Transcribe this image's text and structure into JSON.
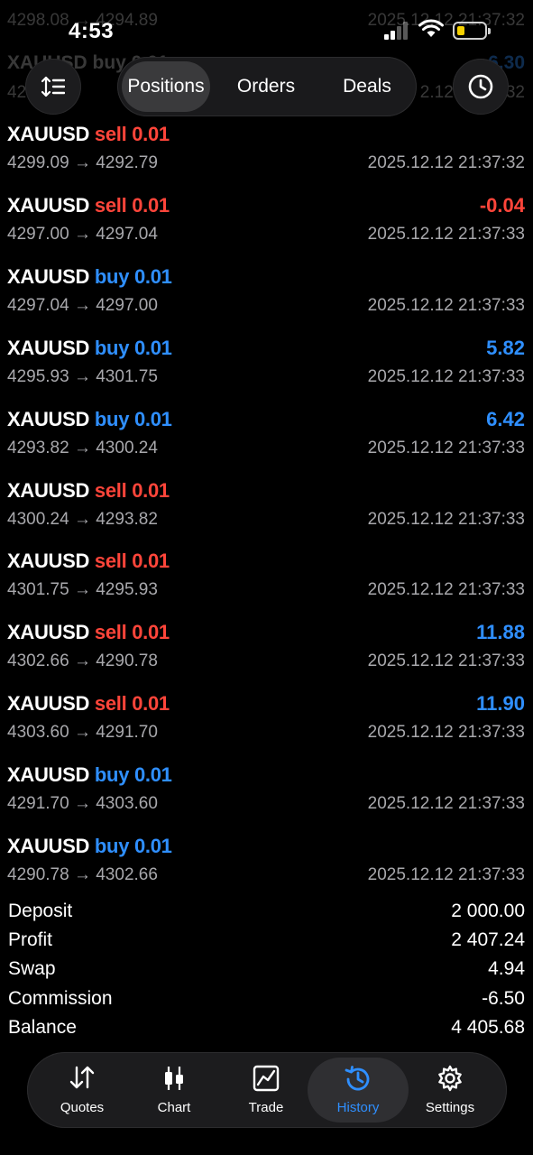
{
  "status_bar": {
    "time": "4:53"
  },
  "ghost_rows": [
    {
      "left": "4298.08 → 4294.89",
      "right": "2025.12.12 21:37:32"
    },
    {
      "left": "XAUUSD buy 0.01",
      "right": "6.30"
    },
    {
      "left": "42 → 42",
      "right": "2.12 21:37:32"
    }
  ],
  "toolbar": {
    "segments": [
      "Positions",
      "Orders",
      "Deals"
    ],
    "active_segment": "Positions"
  },
  "deals": [
    {
      "symbol": "XAUUSD",
      "side": "sell",
      "volume": "0.01",
      "profit": "",
      "prices": "4299.09 → 4292.79",
      "time": "2025.12.12 21:37:32"
    },
    {
      "symbol": "XAUUSD",
      "side": "sell",
      "volume": "0.01",
      "profit": "-0.04",
      "profit_color": "#ff453a",
      "prices": "4297.00 → 4297.04",
      "time": "2025.12.12 21:37:33"
    },
    {
      "symbol": "XAUUSD",
      "side": "buy",
      "volume": "0.01",
      "profit": "",
      "prices": "4297.04 → 4297.00",
      "time": "2025.12.12 21:37:33"
    },
    {
      "symbol": "XAUUSD",
      "side": "buy",
      "volume": "0.01",
      "profit": "5.82",
      "profit_color": "#2f8fff",
      "prices": "4295.93 → 4301.75",
      "time": "2025.12.12 21:37:33"
    },
    {
      "symbol": "XAUUSD",
      "side": "buy",
      "volume": "0.01",
      "profit": "6.42",
      "profit_color": "#2f8fff",
      "prices": "4293.82 → 4300.24",
      "time": "2025.12.12 21:37:33"
    },
    {
      "symbol": "XAUUSD",
      "side": "sell",
      "volume": "0.01",
      "profit": "",
      "prices": "4300.24 → 4293.82",
      "time": "2025.12.12 21:37:33"
    },
    {
      "symbol": "XAUUSD",
      "side": "sell",
      "volume": "0.01",
      "profit": "",
      "prices": "4301.75 → 4295.93",
      "time": "2025.12.12 21:37:33"
    },
    {
      "symbol": "XAUUSD",
      "side": "sell",
      "volume": "0.01",
      "profit": "11.88",
      "profit_color": "#2f8fff",
      "prices": "4302.66 → 4290.78",
      "time": "2025.12.12 21:37:33"
    },
    {
      "symbol": "XAUUSD",
      "side": "sell",
      "volume": "0.01",
      "profit": "11.90",
      "profit_color": "#2f8fff",
      "prices": "4303.60 → 4291.70",
      "time": "2025.12.12 21:37:33"
    },
    {
      "symbol": "XAUUSD",
      "side": "buy",
      "volume": "0.01",
      "profit": "",
      "prices": "4291.70 → 4303.60",
      "time": "2025.12.12 21:37:33"
    },
    {
      "symbol": "XAUUSD",
      "side": "buy",
      "volume": "0.01",
      "profit": "",
      "prices": "4290.78 → 4302.66",
      "time": "2025.12.12 21:37:33"
    }
  ],
  "summary": [
    {
      "label": "Deposit",
      "value": "2 000.00"
    },
    {
      "label": "Profit",
      "value": "2 407.24"
    },
    {
      "label": "Swap",
      "value": "4.94"
    },
    {
      "label": "Commission",
      "value": "-6.50"
    },
    {
      "label": "Balance",
      "value": "4 405.68"
    }
  ],
  "tabbar": {
    "tabs": [
      {
        "label": "Quotes",
        "icon": "quotes-icon"
      },
      {
        "label": "Chart",
        "icon": "candlestick-icon"
      },
      {
        "label": "Trade",
        "icon": "trade-chart-icon"
      },
      {
        "label": "History",
        "icon": "history-icon"
      },
      {
        "label": "Settings",
        "icon": "gear-icon"
      }
    ],
    "active_tab": "History"
  },
  "colors": {
    "sell": "#ff453a",
    "buy": "#2f8fff",
    "background": "#000000",
    "muted": "#a8a8ac"
  }
}
